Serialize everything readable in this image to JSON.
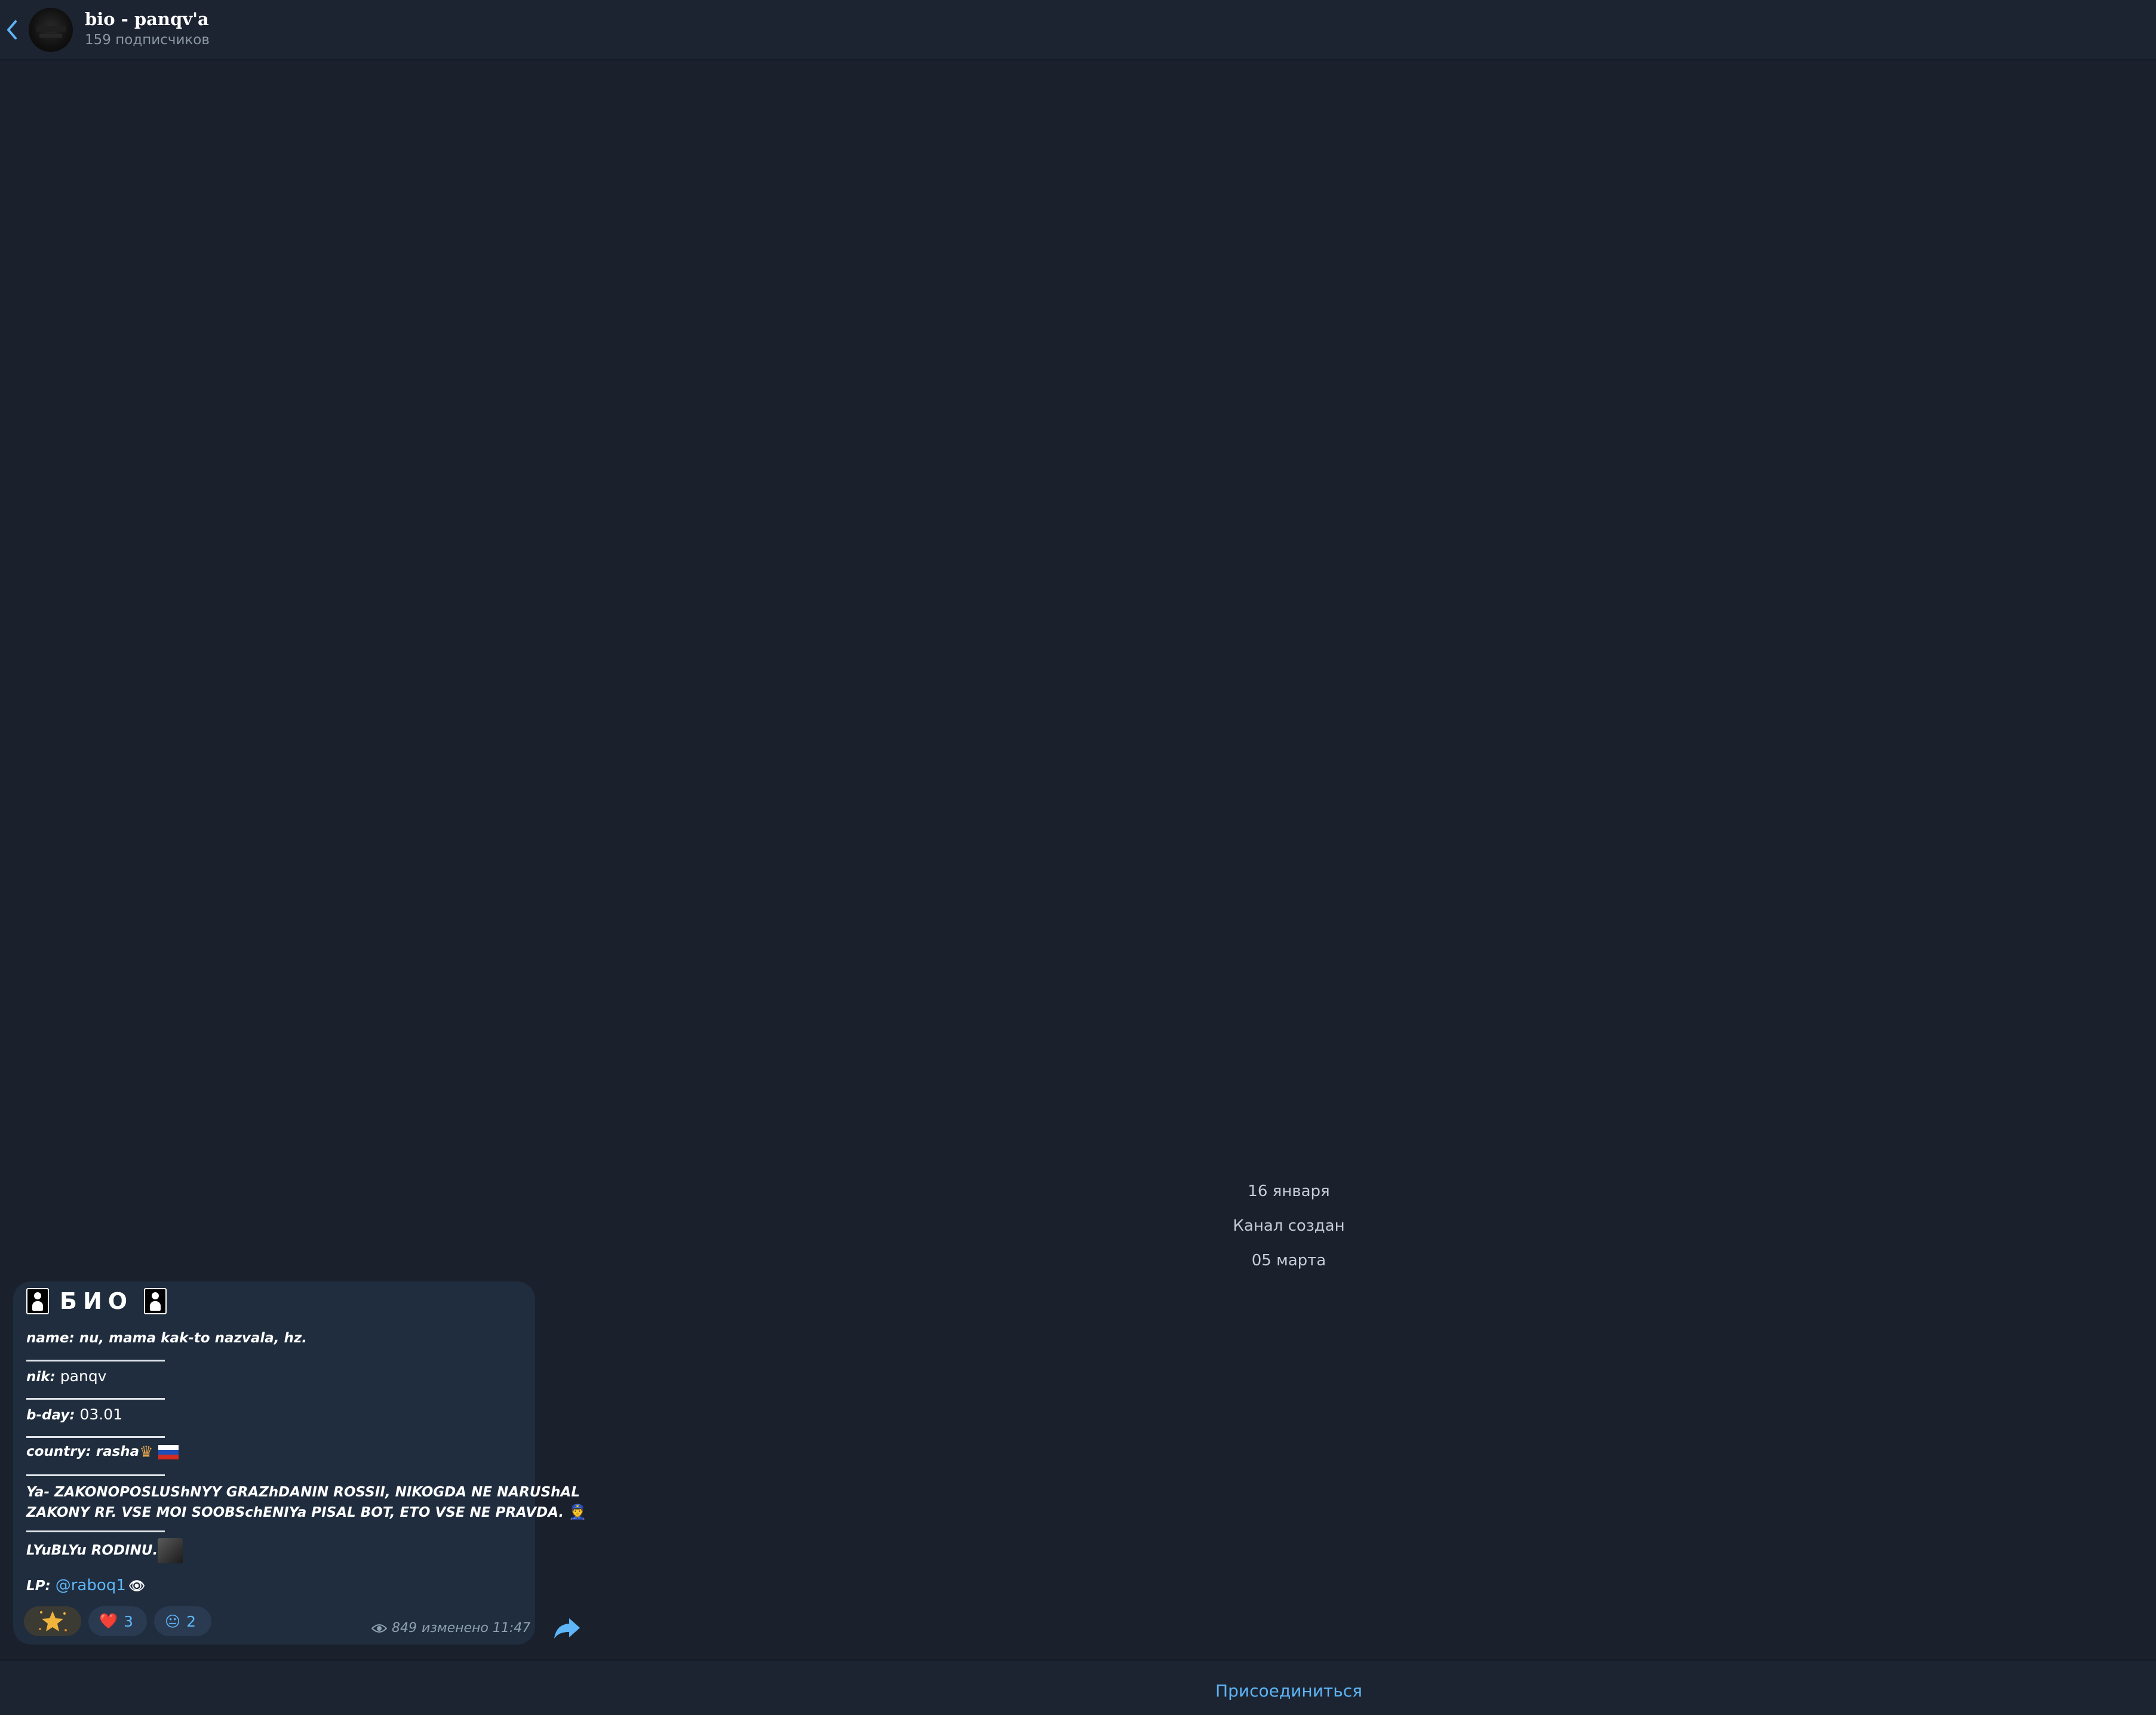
{
  "header": {
    "title": "bio - panqv'a",
    "subtitle": "159 подписчиков"
  },
  "service_messages": {
    "date_1": "16 января",
    "created": "Канал создан",
    "date_2": "05 марта"
  },
  "post": {
    "title": "БИО",
    "lines": {
      "name_label": "name",
      "name_value": ": nu, mama kak-to nazvala, hz.",
      "nik_label": "nik",
      "nik_value": "panqv",
      "bday_label": "b-day",
      "bday_value": "03.01",
      "country_label": "country",
      "country_value": ": rasha",
      "disclaimer_1": "Ya- ZAKONOPOSLUShNYY GRAZhDANIN ROSSII, NIKOGDA NE NARUShAL",
      "disclaimer_2": "ZAKONY RF. VSE MOI SOOBSchENIYa PISAL BOT, ETO VSE NE PRAVDA.",
      "love": "LYuBLYu RODINU.",
      "lp_label": "LP",
      "lp_link": "@raboq1"
    },
    "reactions": [
      {
        "emoji": "star",
        "count": ""
      },
      {
        "emoji": "❤️",
        "count": "3"
      },
      {
        "emoji": "😐",
        "count": "2"
      }
    ],
    "views": "849",
    "edited": "изменено 11:47"
  },
  "footer": {
    "join_label": "Присоединиться"
  },
  "colors": {
    "background": "#1a212c",
    "bubble": "#1f2d3e",
    "accent": "#5eb5f7"
  }
}
